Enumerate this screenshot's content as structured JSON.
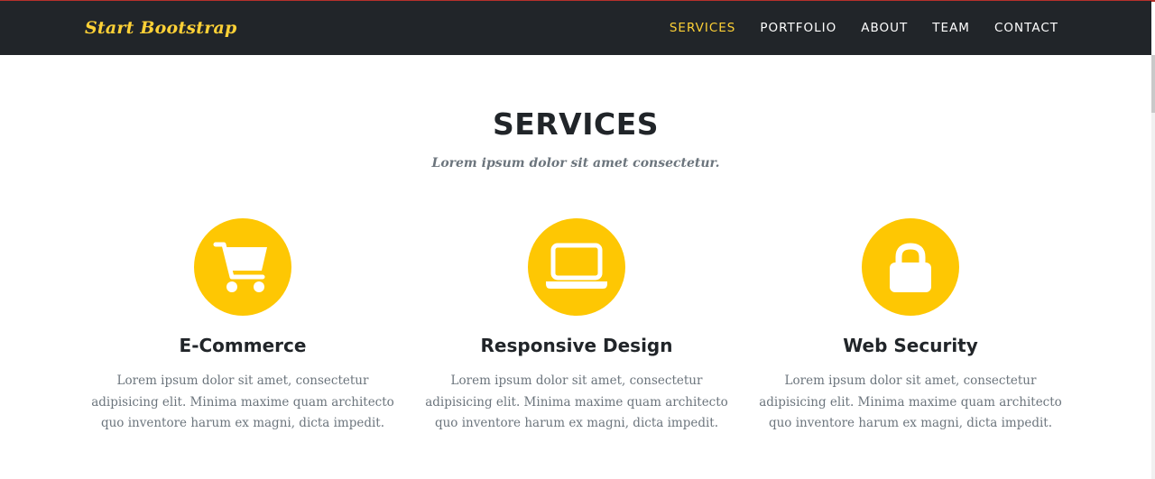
{
  "navbar": {
    "brand": "Start Bootstrap",
    "links": [
      "SERVICES",
      "PORTFOLIO",
      "ABOUT",
      "TEAM",
      "CONTACT"
    ],
    "active_index": 0
  },
  "section": {
    "title": "SERVICES",
    "subheading": "Lorem ipsum dolor sit amet consectetur."
  },
  "services": [
    {
      "icon": "shopping-cart-icon",
      "title": "E-Commerce",
      "text": "Lorem ipsum dolor sit amet, consectetur adipisicing elit. Minima maxime quam architecto quo inventore harum ex magni, dicta impedit."
    },
    {
      "icon": "laptop-icon",
      "title": "Responsive Design",
      "text": "Lorem ipsum dolor sit amet, consectetur adipisicing elit. Minima maxime quam architecto quo inventore harum ex magni, dicta impedit."
    },
    {
      "icon": "lock-icon",
      "title": "Web Security",
      "text": "Lorem ipsum dolor sit amet, consectetur adipisicing elit. Minima maxime quam architecto quo inventore harum ex magni, dicta impedit."
    }
  ],
  "colors": {
    "navbar_bg": "#212529",
    "accent": "#fed136",
    "icon_circle": "#fec703",
    "heading": "#212529",
    "muted_text": "#6c757d"
  }
}
